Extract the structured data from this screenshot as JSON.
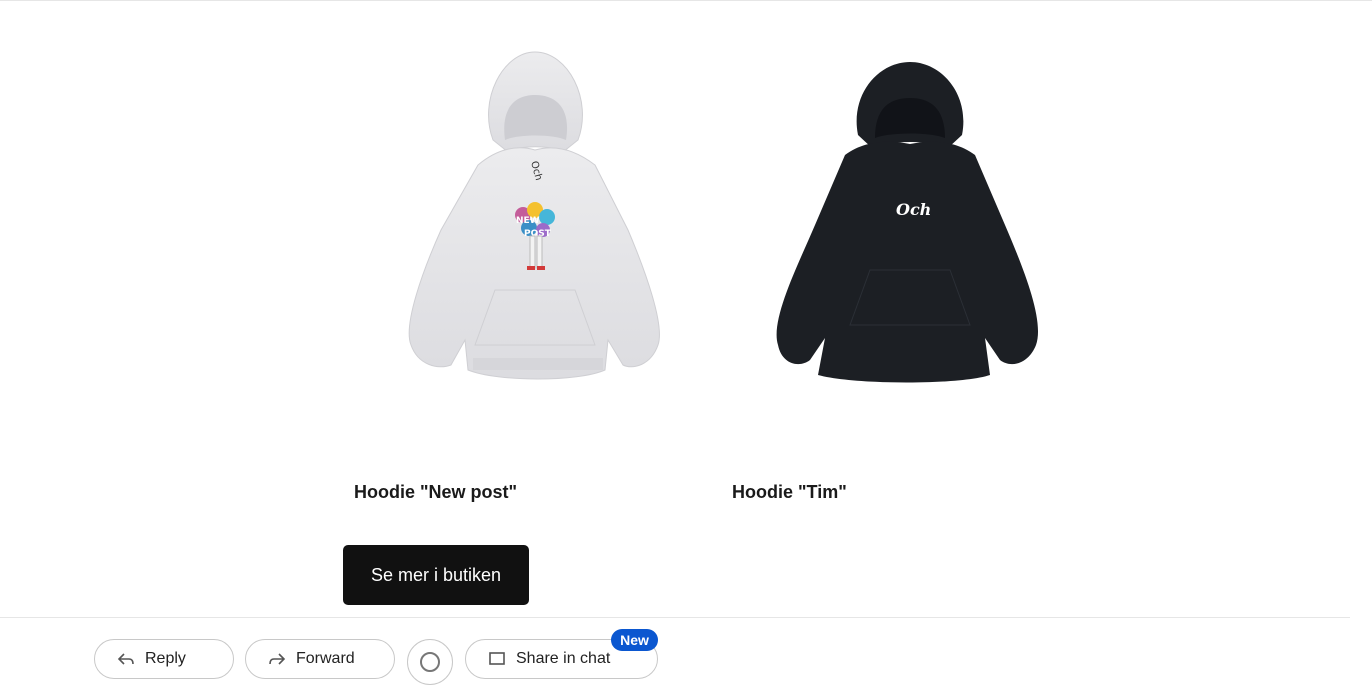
{
  "products": [
    {
      "title": "Hoodie \"New post\"",
      "image_icon": "grey-hoodie-image",
      "print_text": "NEW POST"
    },
    {
      "title": "Hoodie \"Tim\"",
      "image_icon": "black-hoodie-image",
      "print_text": "Och"
    }
  ],
  "cta": {
    "label": "Se mer i butiken"
  },
  "bottom_bar": {
    "buttons": [
      {
        "label": "Reply",
        "icon": "reply-icon"
      },
      {
        "label": "Forward",
        "icon": "forward-icon"
      },
      {
        "label": "",
        "icon": "emoji-icon"
      },
      {
        "label": "Share in chat",
        "icon": "chat-icon"
      }
    ],
    "badge": "New"
  },
  "colors": {
    "cta_bg": "#111111",
    "badge_bg": "#0b57d0",
    "grey_hoodie": "#e7e7e9",
    "black_hoodie": "#1c1f24"
  }
}
